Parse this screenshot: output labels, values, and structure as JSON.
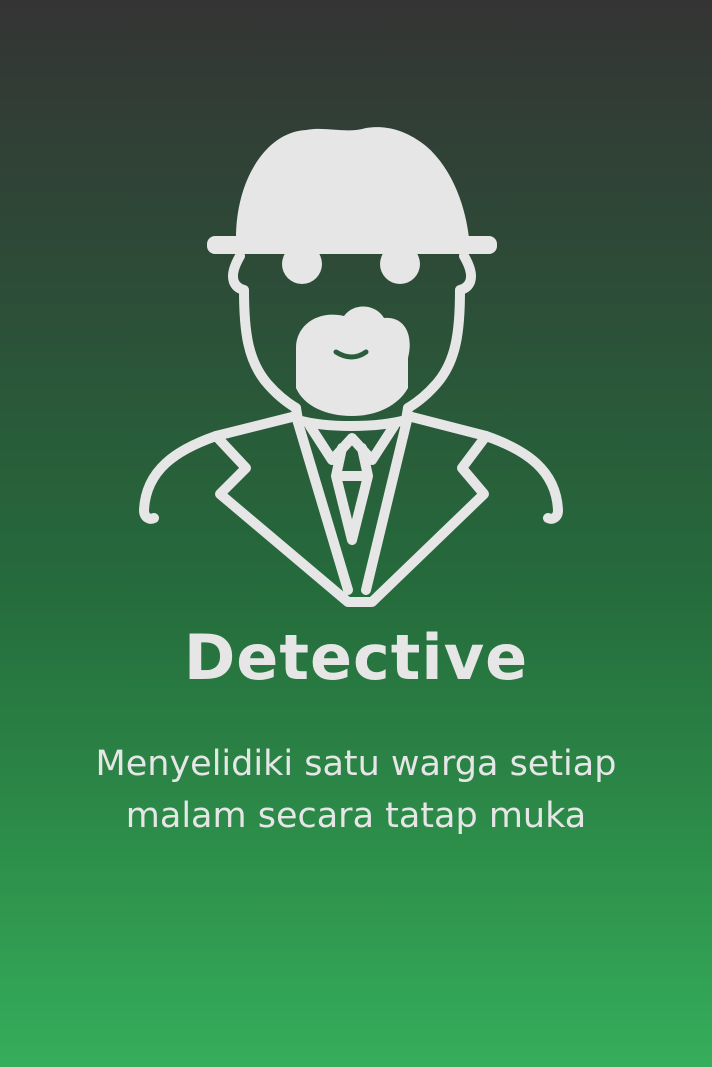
{
  "role": {
    "icon": "detective-icon",
    "title": "Detective",
    "description": "Menyelidiki satu warga setiap malam secara tatap muka"
  },
  "colors": {
    "background_top": "#343434",
    "background_bottom": "#35ae5b",
    "foreground": "#e6e6e6"
  }
}
